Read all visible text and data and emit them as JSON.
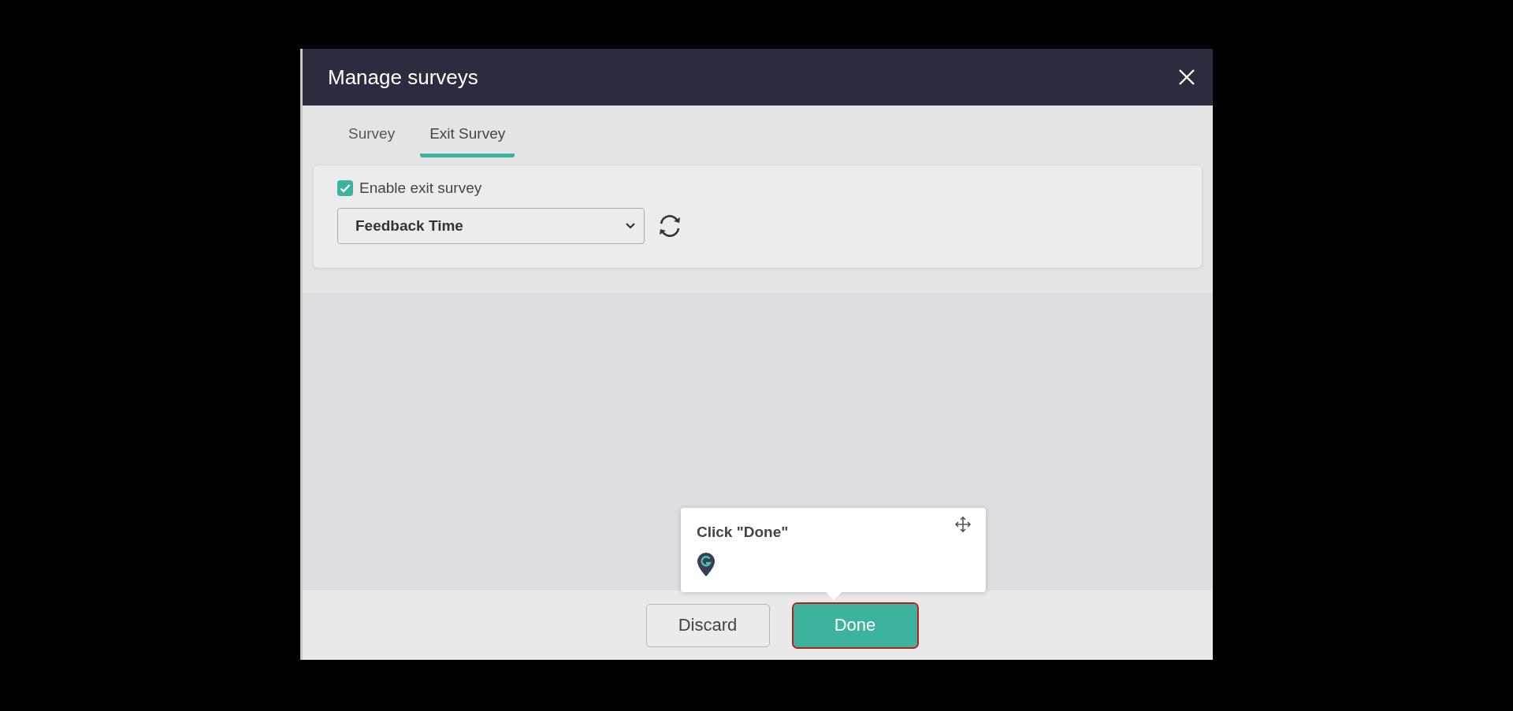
{
  "dialog": {
    "title": "Manage surveys"
  },
  "tabs": [
    {
      "label": "Survey",
      "selected": false
    },
    {
      "label": "Exit Survey",
      "selected": true
    }
  ],
  "settings": {
    "enable_label": "Enable exit survey",
    "enabled": true,
    "survey_select": {
      "value": "Feedback Time"
    }
  },
  "tooltip": {
    "text": "Click \"Done\""
  },
  "buttons": [
    {
      "label": "Discard",
      "kind": "secondary",
      "highlighted": false
    },
    {
      "label": "Done",
      "kind": "primary",
      "highlighted": true
    }
  ]
}
